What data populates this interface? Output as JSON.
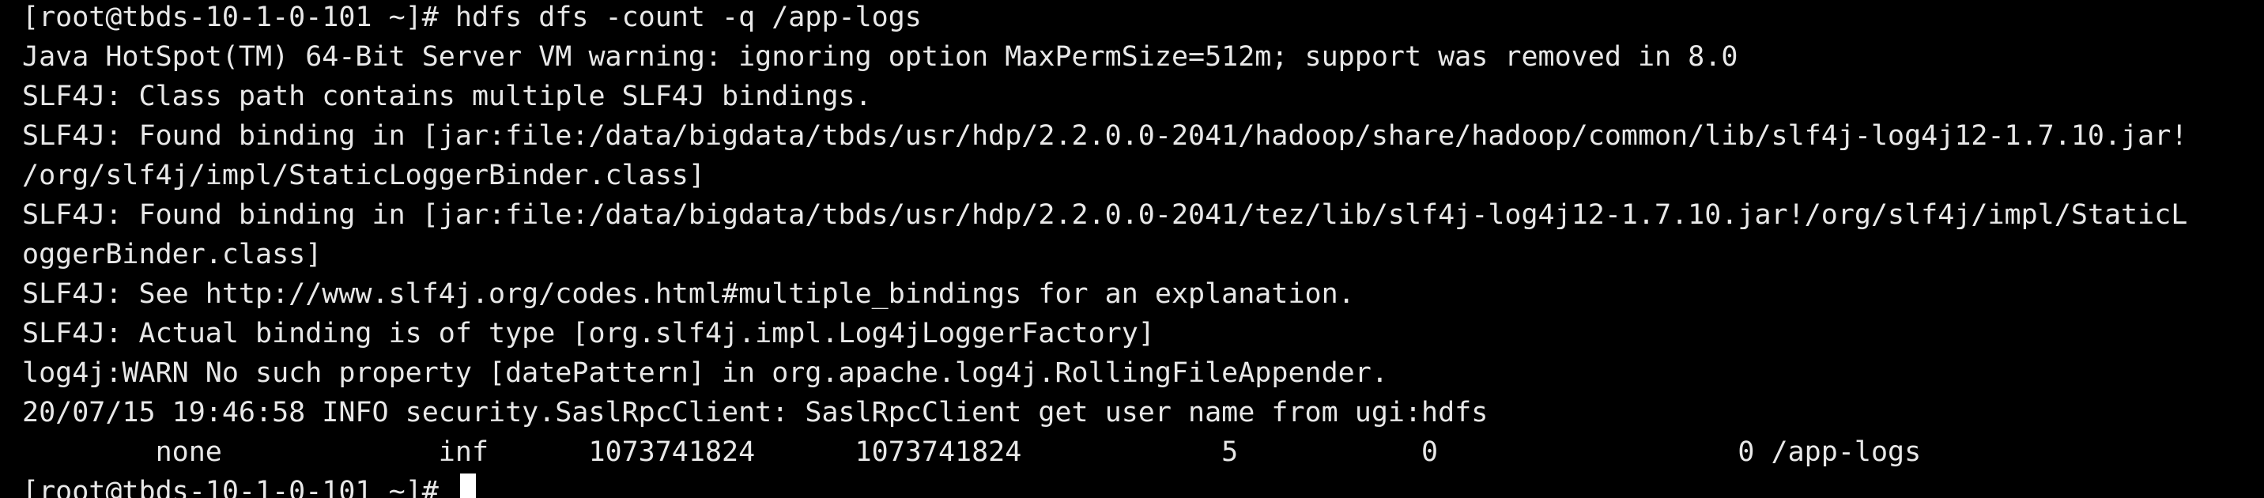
{
  "terminal": {
    "lines": [
      "[root@tbds-10-1-0-101 ~]# hdfs dfs -count -q /app-logs",
      "Java HotSpot(TM) 64-Bit Server VM warning: ignoring option MaxPermSize=512m; support was removed in 8.0",
      "SLF4J: Class path contains multiple SLF4J bindings.",
      "SLF4J: Found binding in [jar:file:/data/bigdata/tbds/usr/hdp/2.2.0.0-2041/hadoop/share/hadoop/common/lib/slf4j-log4j12-1.7.10.jar!",
      "/org/slf4j/impl/StaticLoggerBinder.class]",
      "SLF4J: Found binding in [jar:file:/data/bigdata/tbds/usr/hdp/2.2.0.0-2041/tez/lib/slf4j-log4j12-1.7.10.jar!/org/slf4j/impl/StaticL",
      "oggerBinder.class]",
      "SLF4J: See http://www.slf4j.org/codes.html#multiple_bindings for an explanation.",
      "SLF4J: Actual binding is of type [org.slf4j.impl.Log4jLoggerFactory]",
      "log4j:WARN No such property [datePattern] in org.apache.log4j.RollingFileAppender.",
      "20/07/15 19:46:58 INFO security.SaslRpcClient: SaslRpcClient get user name from ugi:hdfs",
      "        none             inf      1073741824      1073741824            5           0                  0 /app-logs"
    ],
    "prompt": "[root@tbds-10-1-0-101 ~]# "
  }
}
